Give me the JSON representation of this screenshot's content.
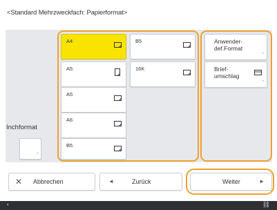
{
  "title": "<Standard Mehrzweckfach: Papierformat>",
  "inch_format": {
    "label": "Inchformat",
    "button_mark": "˹"
  },
  "paper_sizes": [
    {
      "label": "A4",
      "selected": true,
      "orientation": "landscape"
    },
    {
      "label": "B5",
      "selected": false,
      "orientation": "landscape"
    },
    {
      "label": "A5",
      "selected": false,
      "orientation": "portrait"
    },
    {
      "label": "16K",
      "selected": false,
      "orientation": "landscape"
    },
    {
      "label": "A5",
      "selected": false,
      "orientation": "landscape"
    },
    {
      "label": "A6",
      "selected": false,
      "orientation": "landscape"
    },
    {
      "label": "B5",
      "selected": false,
      "orientation": "landscape"
    }
  ],
  "side_buttons": [
    {
      "label": "Anwender-\ndef.Format",
      "mark": "˹"
    },
    {
      "label": "Brief-\numschlag",
      "mark": "˹",
      "icon": "envelope-icon"
    }
  ],
  "footer": {
    "cancel_label": "Abbrechen",
    "back_label": "Zurück",
    "next_label": "Weiter"
  },
  "colors": {
    "selected": "#f8e400",
    "highlight": "#f0a030",
    "panel": "#e6e8ec",
    "statusbar": "#2e3034"
  }
}
